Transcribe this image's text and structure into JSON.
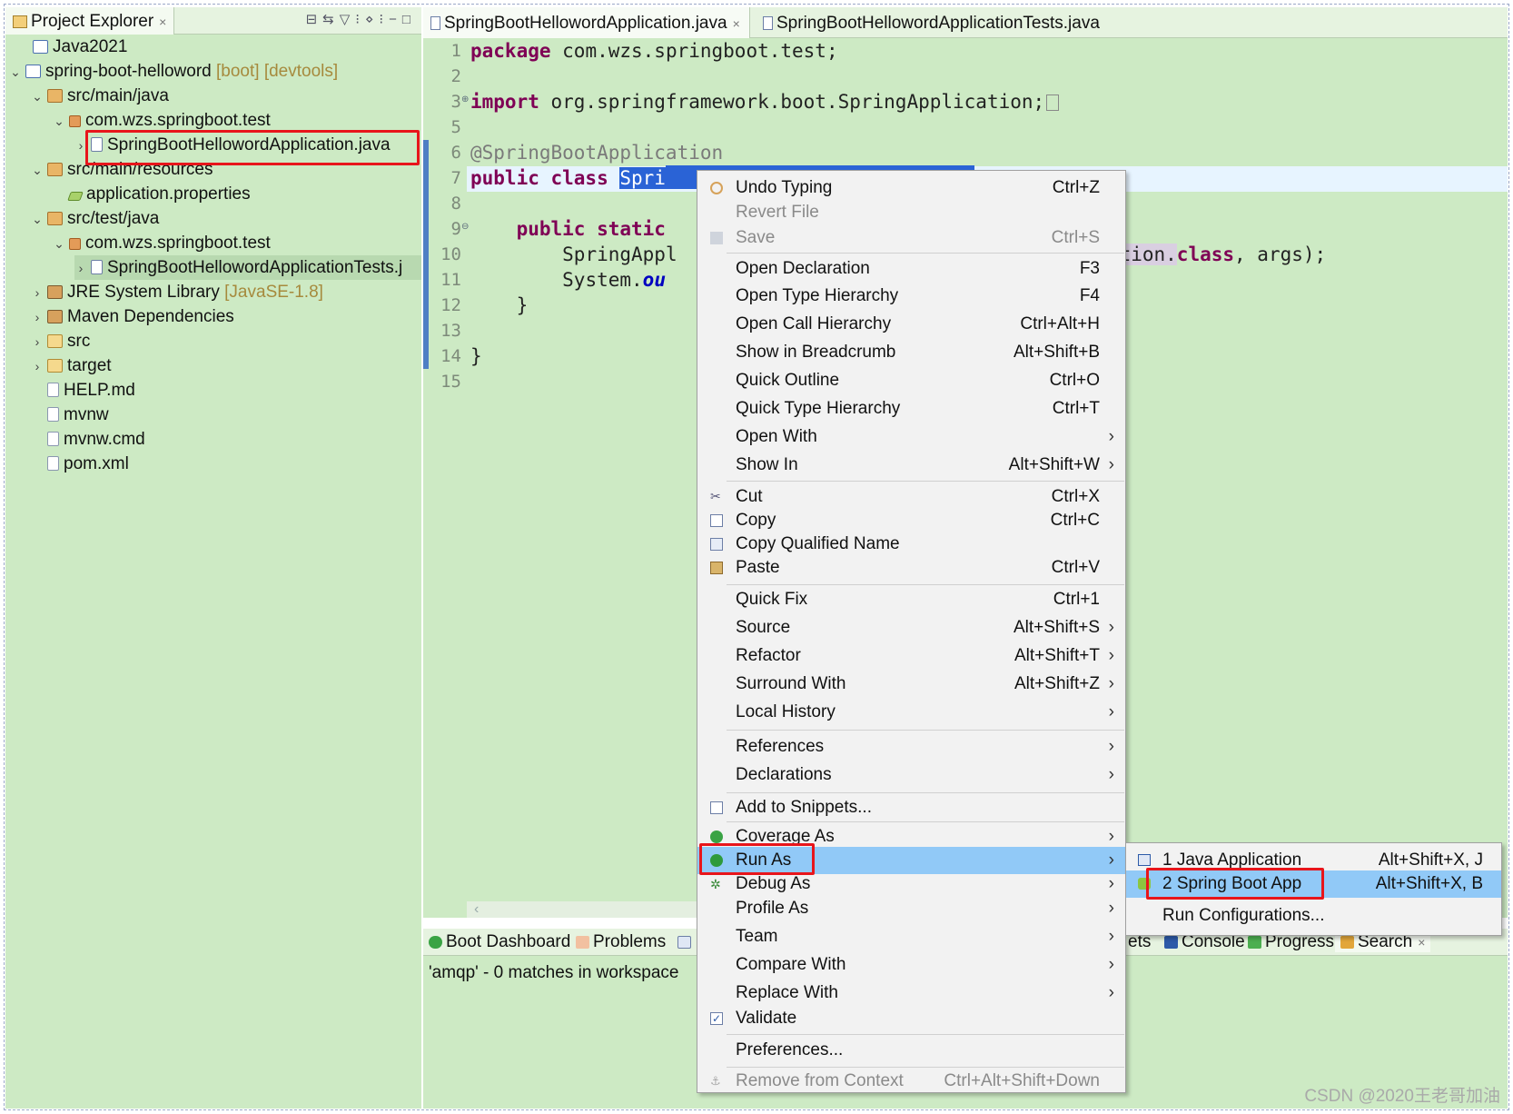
{
  "explorer": {
    "tab_label": "Project Explorer",
    "tab_close": "×",
    "toolbar_glyphs": "⊟⇆▽⁝⋄⁝−□",
    "nodes": [
      {
        "label": "Java2021",
        "decor": ""
      },
      {
        "label": "spring-boot-helloword",
        "decor": "[boot] [devtools]"
      },
      {
        "label": "src/main/java",
        "decor": ""
      },
      {
        "label": "com.wzs.springboot.test",
        "decor": ""
      },
      {
        "label": "SpringBootHellowordApplication.java",
        "decor": ""
      },
      {
        "label": "src/main/resources",
        "decor": ""
      },
      {
        "label": "application.properties",
        "decor": ""
      },
      {
        "label": "src/test/java",
        "decor": ""
      },
      {
        "label": "com.wzs.springboot.test",
        "decor": ""
      },
      {
        "label": "SpringBootHellowordApplicationTests.j",
        "decor": ""
      },
      {
        "label": "JRE System Library",
        "decor": "[JavaSE-1.8]"
      },
      {
        "label": "Maven Dependencies",
        "decor": ""
      },
      {
        "label": "src",
        "decor": ""
      },
      {
        "label": "target",
        "decor": ""
      },
      {
        "label": "HELP.md",
        "decor": ""
      },
      {
        "label": "mvnw",
        "decor": ""
      },
      {
        "label": "mvnw.cmd",
        "decor": ""
      },
      {
        "label": "pom.xml",
        "decor": ""
      }
    ]
  },
  "editor": {
    "tabs": [
      {
        "label": "SpringBootHellowordApplication.java",
        "close": "×"
      },
      {
        "label": "SpringBootHellowordApplicationTests.java"
      }
    ],
    "line_numbers": [
      "1",
      "2",
      "3",
      "5",
      "6",
      "7",
      "8",
      "9",
      "10",
      "11",
      "12",
      "13",
      "14",
      "15"
    ],
    "code": {
      "l1_kw": "package",
      "l1_rest": " com.wzs.springboot.test;",
      "l3_kw": "import",
      "l3_rest": " org.springframework.boot.SpringApplication;",
      "l6": "@SpringBootApplication",
      "l7_kw": "public class",
      "l7_sel": "Spri",
      "l9_kw": "public static",
      "l10": "SpringAppl",
      "l10_right_a": "lication.",
      "l10_right_kw": "class",
      "l10_right_b": ", args);",
      "l11_a": "System.",
      "l11_b": "ou",
      "l12": "}",
      "l14": "}"
    }
  },
  "bottom": {
    "tabs": [
      {
        "label": "Boot Dashboard"
      },
      {
        "label": "Problems"
      }
    ],
    "right_tabs": [
      {
        "label": "ets"
      },
      {
        "label": "Console"
      },
      {
        "label": "Progress"
      },
      {
        "label": "Search",
        "close": "×"
      }
    ],
    "message": "'amqp' - 0 matches in workspace"
  },
  "context_menu": {
    "items": [
      {
        "label": "Undo Typing",
        "shortcut": "Ctrl+Z"
      },
      {
        "label": "Revert File",
        "shortcut": ""
      },
      {
        "label": "Save",
        "shortcut": "Ctrl+S"
      },
      {
        "label": "Open Declaration",
        "shortcut": "F3"
      },
      {
        "label": "Open Type Hierarchy",
        "shortcut": "F4"
      },
      {
        "label": "Open Call Hierarchy",
        "shortcut": "Ctrl+Alt+H"
      },
      {
        "label": "Show in Breadcrumb",
        "shortcut": "Alt+Shift+B"
      },
      {
        "label": "Quick Outline",
        "shortcut": "Ctrl+O"
      },
      {
        "label": "Quick Type Hierarchy",
        "shortcut": "Ctrl+T"
      },
      {
        "label": "Open With",
        "shortcut": ""
      },
      {
        "label": "Show In",
        "shortcut": "Alt+Shift+W"
      },
      {
        "label": "Cut",
        "shortcut": "Ctrl+X"
      },
      {
        "label": "Copy",
        "shortcut": "Ctrl+C"
      },
      {
        "label": "Copy Qualified Name",
        "shortcut": ""
      },
      {
        "label": "Paste",
        "shortcut": "Ctrl+V"
      },
      {
        "label": "Quick Fix",
        "shortcut": "Ctrl+1"
      },
      {
        "label": "Source",
        "shortcut": "Alt+Shift+S"
      },
      {
        "label": "Refactor",
        "shortcut": "Alt+Shift+T"
      },
      {
        "label": "Surround With",
        "shortcut": "Alt+Shift+Z"
      },
      {
        "label": "Local History",
        "shortcut": ""
      },
      {
        "label": "References",
        "shortcut": ""
      },
      {
        "label": "Declarations",
        "shortcut": ""
      },
      {
        "label": "Add to Snippets...",
        "shortcut": ""
      },
      {
        "label": "Coverage As",
        "shortcut": ""
      },
      {
        "label": "Run As",
        "shortcut": ""
      },
      {
        "label": "Debug As",
        "shortcut": ""
      },
      {
        "label": "Profile As",
        "shortcut": ""
      },
      {
        "label": "Team",
        "shortcut": ""
      },
      {
        "label": "Compare With",
        "shortcut": ""
      },
      {
        "label": "Replace With",
        "shortcut": ""
      },
      {
        "label": "Validate",
        "shortcut": ""
      },
      {
        "label": "Preferences...",
        "shortcut": ""
      },
      {
        "label": "Remove from Context",
        "shortcut": "Ctrl+Alt+Shift+Down"
      }
    ],
    "submenu_arrow": "›"
  },
  "submenu": {
    "items": [
      {
        "label": "1 Java Application",
        "shortcut": "Alt+Shift+X, J"
      },
      {
        "label": "2 Spring Boot App",
        "shortcut": "Alt+Shift+X, B"
      },
      {
        "label": "Run Configurations...",
        "shortcut": ""
      }
    ]
  },
  "watermark": "CSDN @2020王老哥加油",
  "colors": {
    "view_background": "#cdeac4",
    "menu_highlight": "#91c9f7",
    "annotation_box": "#e8151b",
    "keyword": "#7f0055"
  }
}
